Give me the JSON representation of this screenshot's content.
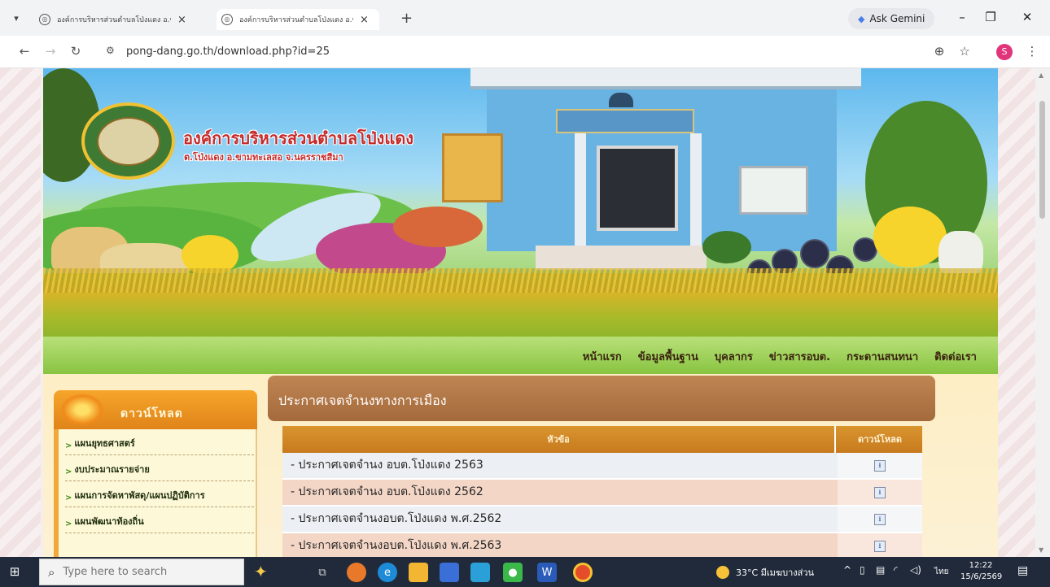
{
  "browser": {
    "tabs": [
      {
        "title": "องค์การบริหารส่วนตำบลโป่งแดง อ.ข",
        "active": false
      },
      {
        "title": "องค์การบริหารส่วนตำบลโป่งแดง อ.ข",
        "active": true
      }
    ],
    "gemini_label": "Ask Gemini",
    "url": "pong-dang.go.th/download.php?id=25",
    "profile_initial": "S"
  },
  "site": {
    "org_name": "องค์การบริหารส่วนตำบลโป่งแดง",
    "org_subtitle": "ต.โป่งแดง อ.ขามทะเลสอ จ.นครราชสีมา",
    "nav": [
      "หน้าแรก",
      "ข้อมูลพื้นฐาน",
      "บุคลากร",
      "ข่าวสารอบต.",
      "กระดานสนทนา",
      "ติดต่อเรา"
    ],
    "sidebar": {
      "title": "ดาวน์โหลด",
      "items": [
        "แผนยุทธศาสตร์",
        "งบประมาณรายจ่าย",
        "แผนการจัดหาพัสดุ/แผนปฏิบัติการ",
        "แผนพัฒนาท้องถิ่น"
      ]
    },
    "main": {
      "title": "ประกาศเจตจำนงทางการเมือง",
      "columns": [
        "หัวข้อ",
        "ดาวน์โหลด"
      ],
      "rows": [
        "- ประกาศเจตจำนง อบต.โป่งแดง 2563",
        "- ประกาศเจตจำนง อบต.โป่งแดง 2562",
        "- ประกาศเจตจำนงอบต.โป่งแดง พ.ศ.2562",
        "- ประกาศเจตจำนงอบต.โป่งแดง พ.ศ.2563"
      ]
    }
  },
  "taskbar": {
    "search_placeholder": "Type here to search",
    "weather": "33°C มีเมฆบางส่วน",
    "language": "ไทย",
    "time": "12:22",
    "date": "15/6/2569"
  },
  "colors": {
    "nav_green": "#88c441",
    "title_brown": "#a56a3c",
    "table_header_orange": "#c77a1e",
    "org_red": "#c62a2a"
  }
}
